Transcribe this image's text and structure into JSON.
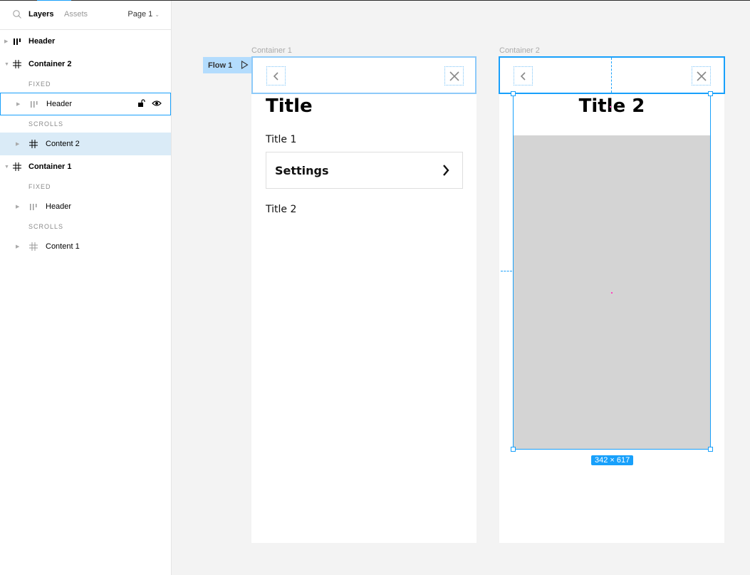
{
  "sidebar": {
    "tabs": {
      "layers": "Layers",
      "assets": "Assets",
      "page": "Page 1"
    },
    "layers": [
      {
        "label": "Header",
        "type": "top",
        "icon": "columns-icon",
        "expanded": false
      },
      {
        "label": "Container 2",
        "type": "top",
        "icon": "frame-icon",
        "expanded": true
      },
      {
        "section": "FIXED"
      },
      {
        "label": "Header",
        "type": "child",
        "icon": "columns-icon",
        "hovered": true
      },
      {
        "section": "SCROLLS"
      },
      {
        "label": "Content 2",
        "type": "child",
        "icon": "frame-icon",
        "selected": true
      },
      {
        "label": "Container 1",
        "type": "top",
        "icon": "frame-icon",
        "expanded": true
      },
      {
        "section": "FIXED"
      },
      {
        "label": "Header",
        "type": "child",
        "icon": "columns-icon"
      },
      {
        "section": "SCROLLS"
      },
      {
        "label": "Content 1",
        "type": "child",
        "icon": "frame-icon"
      }
    ]
  },
  "canvas": {
    "flow_label": "Flow 1",
    "frame1": {
      "label": "Container 1",
      "title": "Title",
      "item1": "Title 1",
      "settings": "Settings",
      "item2": "Title 2"
    },
    "frame2": {
      "label": "Container 2",
      "title": "Title 2",
      "size_badge": "342 × 617"
    }
  },
  "colors": {
    "accent": "#18a0fb",
    "selection_bg": "#daebf7",
    "flow_tag": "#b3dcfd",
    "content_gray": "#d4d4d4"
  }
}
